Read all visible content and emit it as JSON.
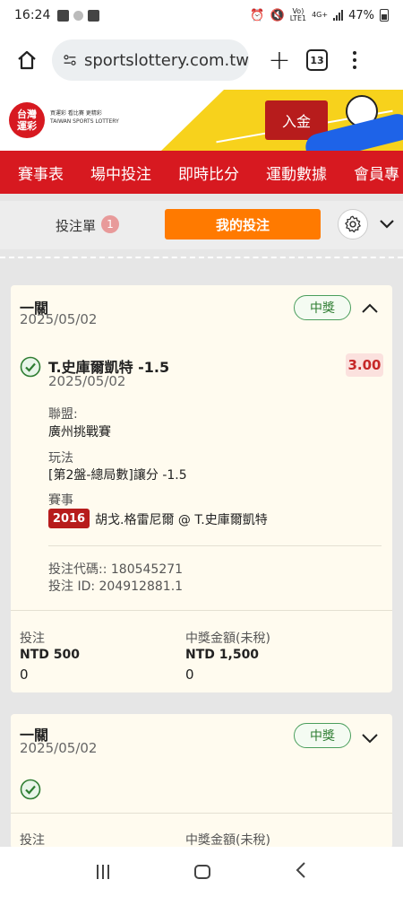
{
  "status": {
    "time": "16:24",
    "network": "4G+",
    "lte": "LTE1",
    "volte": "Vo)",
    "battery": "47%"
  },
  "browser": {
    "url": "sportslottery.com.tw",
    "tab_count": "13"
  },
  "site": {
    "logo_line1": "台灣",
    "logo_line2": "運彩",
    "tagline": "買運彩  看比賽  更精彩",
    "tagline_en": "TAIWAN SPORTS LOTTERY",
    "deposit_label": "入金"
  },
  "nav": {
    "items": [
      "賽事表",
      "場中投注",
      "即時比分",
      "運動數據",
      "會員專"
    ]
  },
  "slip": {
    "label": "投注單",
    "count": "1",
    "my_bets": "我的投注"
  },
  "bets": [
    {
      "type": "一關",
      "date": "2025/05/02",
      "status": "中獎",
      "selection": "T.史庫爾凱特 -1.5",
      "selection_date": "2025/05/02",
      "odds": "3.00",
      "league_label": "聯盟:",
      "league": "廣州挑戰賽",
      "play_label": "玩法",
      "play": "[第2盤-總局數]讓分 -1.5",
      "event_label": "賽事",
      "event_year": "2016",
      "event": "胡戈.格雷尼爾 @ T.史庫爾凱特",
      "code_line": "投注代碼:: 180545271",
      "id_line": "投注 ID: 204912881.1",
      "stake_label": "投注",
      "stake": "NTD 500",
      "stake_zero": "0",
      "payout_label": "中獎金額(未稅)",
      "payout": "NTD 1,500",
      "payout_zero": "0"
    },
    {
      "type": "一關",
      "date": "2025/05/02",
      "status": "中獎",
      "stake_label": "投注",
      "payout_label": "中獎金額(未稅)"
    }
  ]
}
